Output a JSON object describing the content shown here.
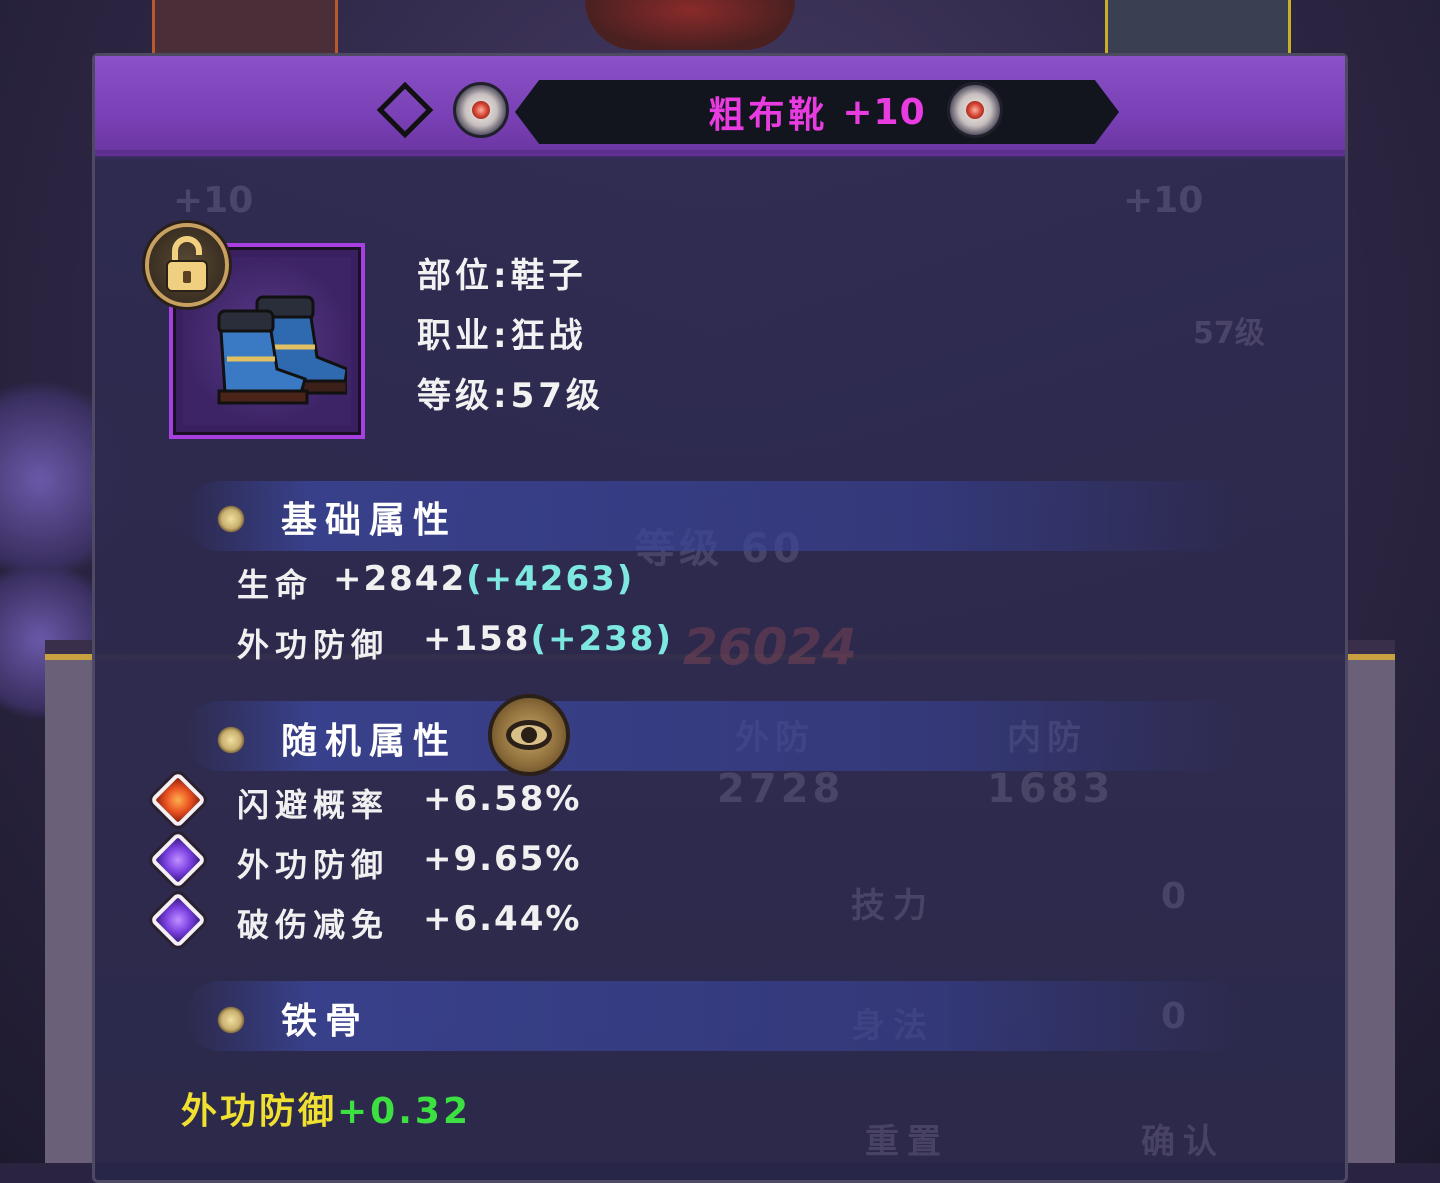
{
  "item": {
    "name": "粗布靴",
    "enhance": "+10",
    "slot_line": "部位:鞋子",
    "class_line": "职业:狂战",
    "level_line": "等级:57级",
    "lock_state": "unlocked-lock-icon"
  },
  "base_attributes": {
    "title": "基础属性",
    "stats": [
      {
        "label": "生命",
        "value": "+2842",
        "bonus": "(+4263)"
      },
      {
        "label": "外功防御",
        "value": "+158",
        "bonus": "(+238)"
      }
    ]
  },
  "random_attributes": {
    "title": "随机属性",
    "stats": [
      {
        "gem": "orange-gem-icon",
        "label": "闪避概率",
        "value": "+6.58%"
      },
      {
        "gem": "purple-gem-icon",
        "label": "外功防御",
        "value": "+9.65%"
      },
      {
        "gem": "purple-gem-icon",
        "label": "破伤减免",
        "value": "+6.44%"
      }
    ]
  },
  "set_section": {
    "title": "铁骨",
    "bonus_name": "外功防御",
    "bonus_value": "+0.32"
  },
  "background_ghost": {
    "left_card_level": "+10",
    "right_card_level": "+10",
    "right_card_sub": "57级",
    "hero_level": "等级 60",
    "power": "26024",
    "def_outer_label": "外防",
    "def_outer_value": "2728",
    "def_inner_label": "内防",
    "def_inner_value": "1683",
    "skill_label": "技力",
    "skill_value": "0",
    "agility_label": "身法",
    "agility_value": "0",
    "reset_label": "重置",
    "confirm_label": "确认"
  },
  "colors": {
    "title": "#e83ce0",
    "bonus": "#7ee8e0",
    "set_name": "#f0e030",
    "set_value": "#3ce040",
    "header": "#7a40b6"
  }
}
